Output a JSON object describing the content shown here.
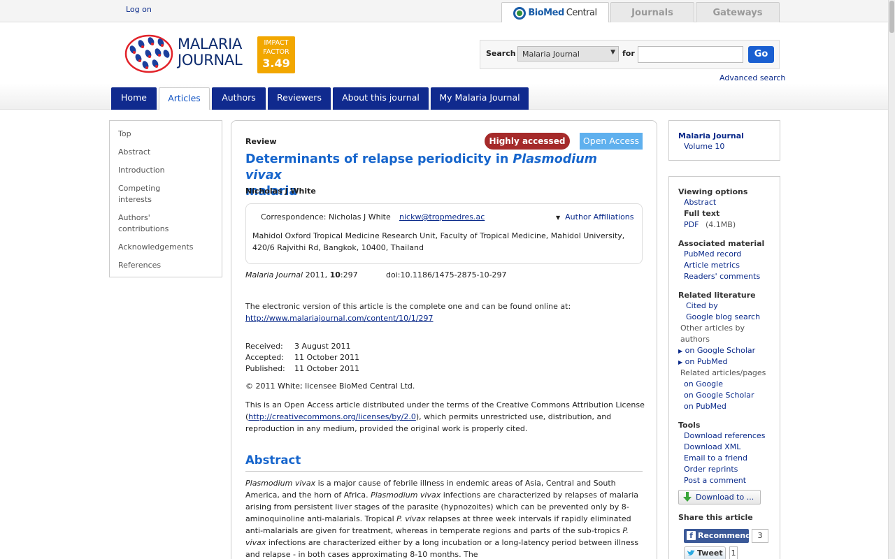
{
  "topbar": {
    "login": "Log on",
    "tabs": {
      "biomed_bio": "BioMed",
      "biomed_central": "Central",
      "journals": "Journals",
      "gateways": "Gateways"
    }
  },
  "header": {
    "logo_line1": "MALARIA",
    "logo_line2": "JOURNAL",
    "impact_label1": "IMPACT",
    "impact_label2": "FACTOR",
    "impact_value": "3.49",
    "search_label": "Search",
    "search_scope": "Malaria Journal",
    "for_label": "for",
    "search_value": "",
    "go": "Go",
    "advanced": "Advanced search"
  },
  "nav": [
    "Home",
    "Articles",
    "Authors",
    "Reviewers",
    "About this journal",
    "My Malaria Journal"
  ],
  "sidebar_left": [
    "Top",
    "Abstract",
    "Introduction",
    "Competing",
    "interests",
    "Authors'",
    "contributions",
    "Acknowledgements",
    "References"
  ],
  "article": {
    "type": "Review",
    "badge_highly": "Highly accessed",
    "badge_open": "Open Access",
    "title_plain": "Determinants of relapse periodicity in ",
    "title_italic": "Plasmodium vivax",
    "title_end": "malaria",
    "author": "Nicholas J White",
    "corr_label": "Correspondence: Nicholas J White",
    "corr_email": "nickw@tropmedres.ac",
    "affil_toggle": "Author Affiliations",
    "affil_text": "Mahidol Oxford Tropical Medicine Research Unit, Faculty of Tropical Medicine, Mahidol University, 420/6 Rajvithi Rd, Bangkok, 10400, Thailand",
    "cite_journal": "Malaria Journal",
    "cite_year": " 2011, ",
    "cite_vol": "10",
    "cite_page": ":297",
    "doi": "doi:10.1186/1475-2875-10-297",
    "evers": "The electronic version of this article is the complete one and can be found online at:",
    "url": "http://www.malariajournal.com/content/10/1/297",
    "received_l": "Received:",
    "received_v": "3 August 2011",
    "accepted_l": "Accepted:",
    "accepted_v": "11 October 2011",
    "published_l": "Published:",
    "published_v": "11 October 2011",
    "copyright": "© 2011 White; licensee BioMed Central Ltd.",
    "license_a": "This is an Open Access article distributed under the terms of the Creative Commons Attribution License (",
    "license_url": "http://creativecommons.org/licenses/by/2.0",
    "license_b": "), which permits unrestricted use, distribution, and reproduction in any medium, provided the original work is properly cited.",
    "abstract_heading": "Abstract",
    "abs_1i": "Plasmodium vivax",
    "abs_1": " is a major cause of febrile illness in endemic areas of Asia, Central and South America, and the horn of Africa. ",
    "abs_2i": "Plasmodium vivax",
    "abs_2": " infections are characterized by relapses of malaria arising from persistent liver stages of the parasite (hypnozoites) which can be prevented only by 8-aminoquinoline anti-malarials. Tropical ",
    "abs_3i": "P. vivax",
    "abs_3": " relapses at three week intervals if rapidly eliminated anti-malarials are given for treatment, whereas in temperate regions and parts of the sub-tropics ",
    "abs_4i": "P. vivax",
    "abs_4": " infections are characterized either by a long incubation or a long-latency period between illness and relapse - in both cases approximating 8-10 months. The"
  },
  "right": {
    "journal": "Malaria Journal",
    "volume": "Volume 10",
    "viewing": "Viewing options",
    "abstract": "Abstract",
    "fulltext": "Full text",
    "pdf": "PDF",
    "pdf_size": "(4.1MB)",
    "assoc": "Associated material",
    "pubmed_record": "PubMed record",
    "metrics": "Article metrics",
    "comments": "Readers' comments",
    "related": "Related literature",
    "cited_by": "Cited by",
    "google_blog": "Google blog search",
    "other_articles": "Other articles by",
    "authors": "authors",
    "on_scholar": "on Google Scholar",
    "on_pubmed": "on PubMed",
    "related_pages": "Related articles/pages",
    "on_google": "on Google",
    "on_scholar2": "on Google Scholar",
    "on_pubmed2": "on PubMed",
    "tools": "Tools",
    "dl_refs": "Download references",
    "dl_xml": "Download XML",
    "email_friend": "Email to a friend",
    "reprints": "Order reprints",
    "post_comment": "Post a comment",
    "download_to": "Download to ...",
    "share": "Share this article",
    "recommend": "Recommend",
    "recommend_count": "3",
    "tweet": "Tweet",
    "tweet_count": "1"
  }
}
